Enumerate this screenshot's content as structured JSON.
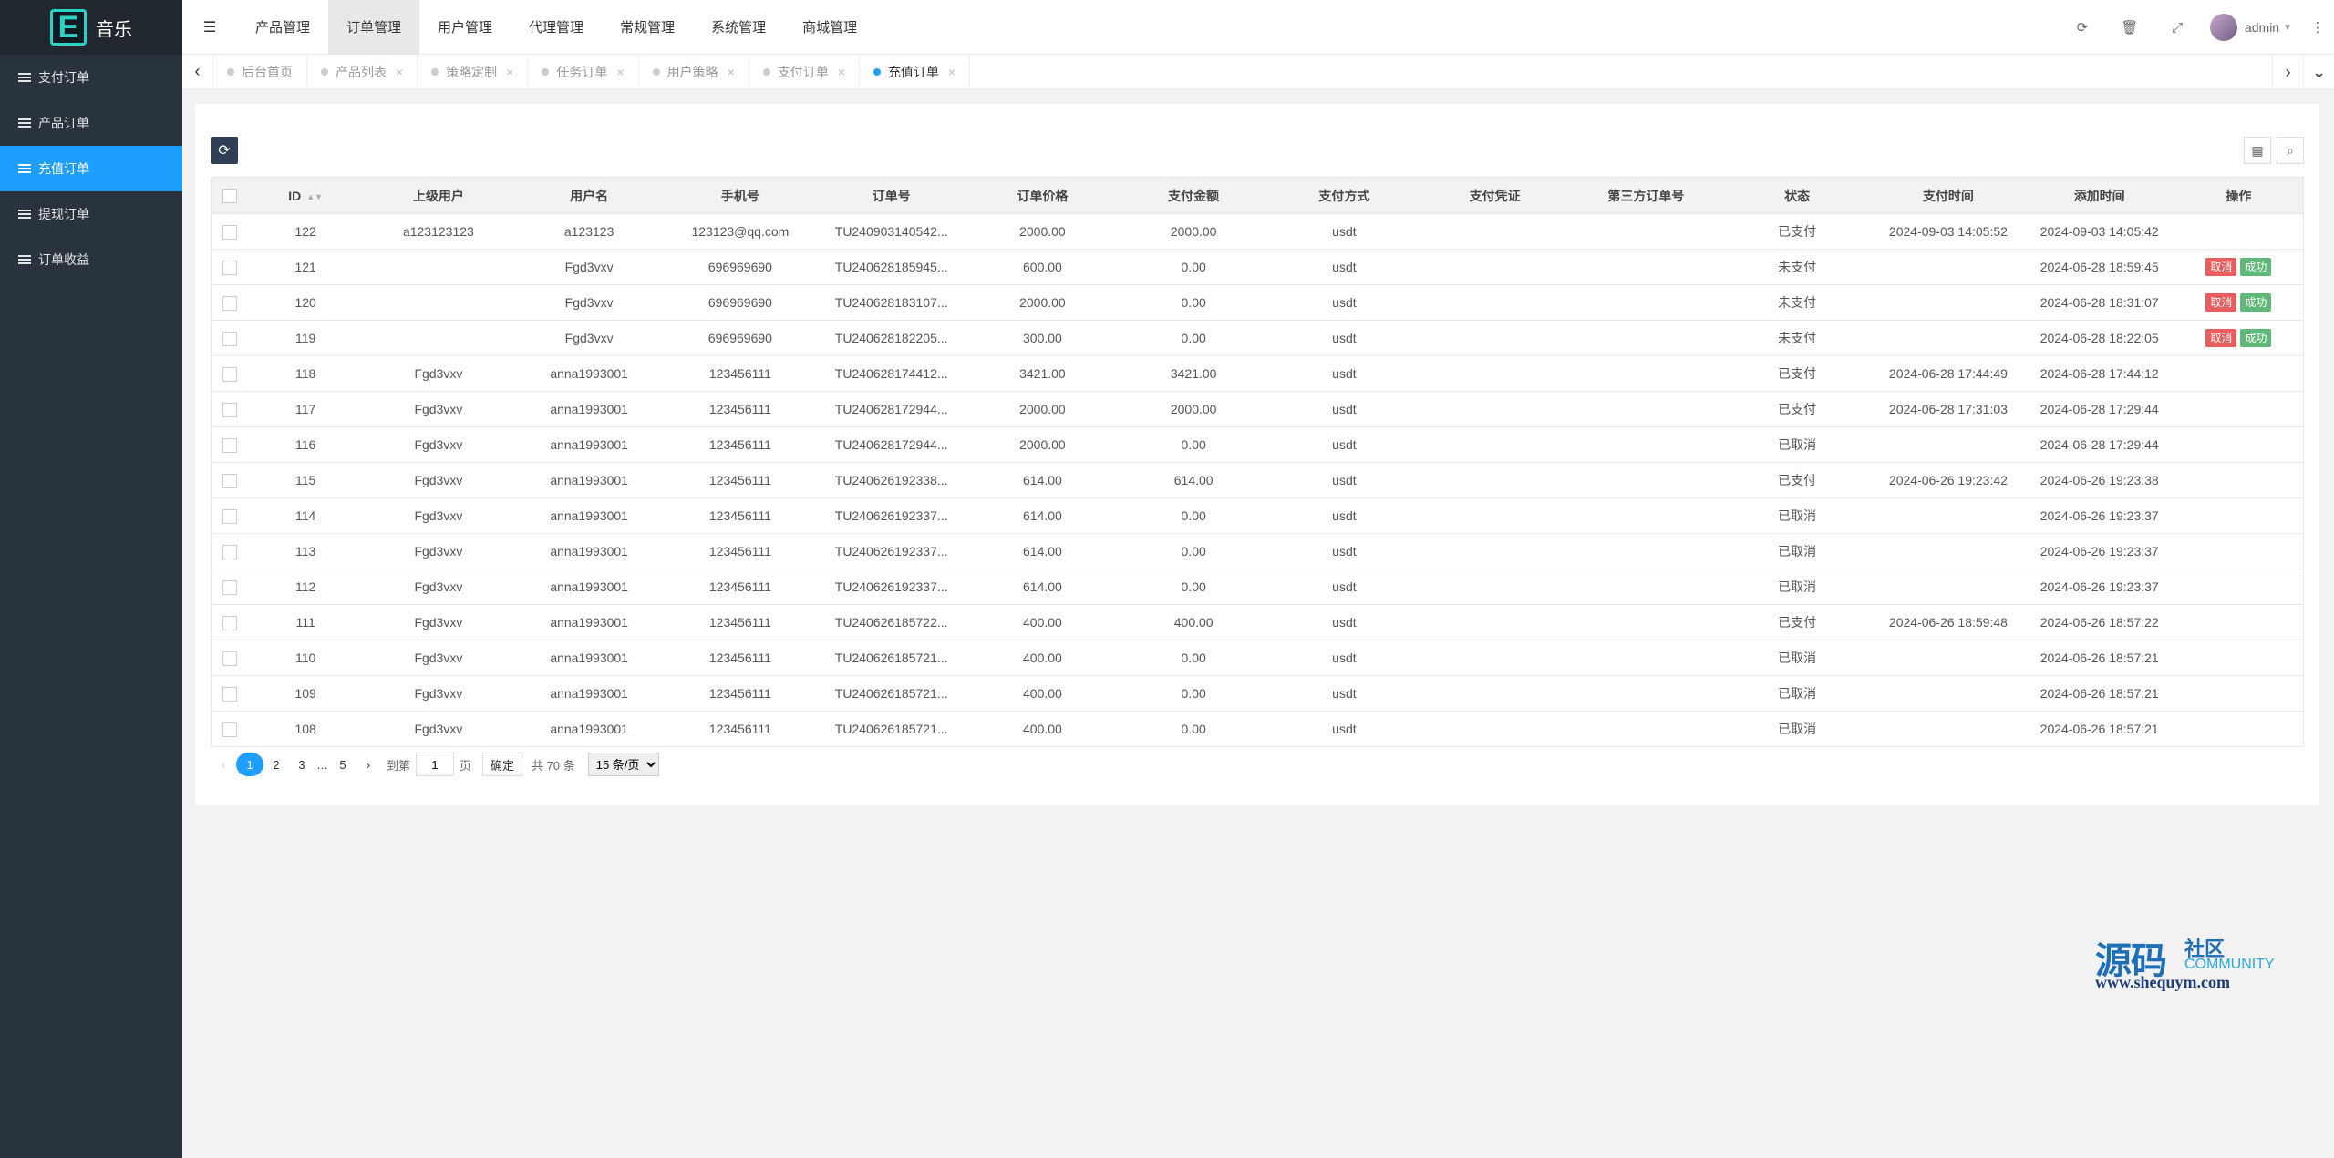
{
  "app": {
    "logo_letter": "E",
    "title": "音乐"
  },
  "sidebar": {
    "items": [
      {
        "label": "支付订单",
        "active": false
      },
      {
        "label": "产品订单",
        "active": false
      },
      {
        "label": "充值订单",
        "active": true
      },
      {
        "label": "提现订单",
        "active": false
      },
      {
        "label": "订单收益",
        "active": false
      }
    ]
  },
  "header": {
    "nav": [
      {
        "label": "产品管理",
        "active": false
      },
      {
        "label": "订单管理",
        "active": true
      },
      {
        "label": "用户管理",
        "active": false
      },
      {
        "label": "代理管理",
        "active": false
      },
      {
        "label": "常规管理",
        "active": false
      },
      {
        "label": "系统管理",
        "active": false
      },
      {
        "label": "商城管理",
        "active": false
      }
    ],
    "user": "admin"
  },
  "tabs": [
    {
      "label": "后台首页",
      "closable": false,
      "active": false
    },
    {
      "label": "产品列表",
      "closable": true,
      "active": false
    },
    {
      "label": "策略定制",
      "closable": true,
      "active": false
    },
    {
      "label": "任务订单",
      "closable": true,
      "active": false
    },
    {
      "label": "用户策略",
      "closable": true,
      "active": false
    },
    {
      "label": "支付订单",
      "closable": true,
      "active": false
    },
    {
      "label": "充值订单",
      "closable": true,
      "active": true
    }
  ],
  "table": {
    "columns": [
      "ID",
      "上级用户",
      "用户名",
      "手机号",
      "订单号",
      "订单价格",
      "支付金额",
      "支付方式",
      "支付凭证",
      "第三方订单号",
      "状态",
      "支付时间",
      "添加时间",
      "操作"
    ],
    "rows": [
      [
        "122",
        "a123123123",
        "a123123",
        "123123@qq.com",
        "TU240903140542...",
        "2000.00",
        "2000.00",
        "usdt",
        "",
        "",
        "已支付",
        "2024-09-03 14:05:52",
        "2024-09-03 14:05:42",
        ""
      ],
      [
        "121",
        "",
        "Fgd3vxv",
        "696969690",
        "TU240628185945...",
        "600.00",
        "0.00",
        "usdt",
        "",
        "",
        "未支付",
        "",
        "2024-06-28 18:59:45",
        "actions"
      ],
      [
        "120",
        "",
        "Fgd3vxv",
        "696969690",
        "TU240628183107...",
        "2000.00",
        "0.00",
        "usdt",
        "",
        "",
        "未支付",
        "",
        "2024-06-28 18:31:07",
        "actions"
      ],
      [
        "119",
        "",
        "Fgd3vxv",
        "696969690",
        "TU240628182205...",
        "300.00",
        "0.00",
        "usdt",
        "",
        "",
        "未支付",
        "",
        "2024-06-28 18:22:05",
        "actions"
      ],
      [
        "118",
        "Fgd3vxv",
        "anna1993001",
        "123456111",
        "TU240628174412...",
        "3421.00",
        "3421.00",
        "usdt",
        "",
        "",
        "已支付",
        "2024-06-28 17:44:49",
        "2024-06-28 17:44:12",
        ""
      ],
      [
        "117",
        "Fgd3vxv",
        "anna1993001",
        "123456111",
        "TU240628172944...",
        "2000.00",
        "2000.00",
        "usdt",
        "",
        "",
        "已支付",
        "2024-06-28 17:31:03",
        "2024-06-28 17:29:44",
        ""
      ],
      [
        "116",
        "Fgd3vxv",
        "anna1993001",
        "123456111",
        "TU240628172944...",
        "2000.00",
        "0.00",
        "usdt",
        "",
        "",
        "已取消",
        "",
        "2024-06-28 17:29:44",
        ""
      ],
      [
        "115",
        "Fgd3vxv",
        "anna1993001",
        "123456111",
        "TU240626192338...",
        "614.00",
        "614.00",
        "usdt",
        "",
        "",
        "已支付",
        "2024-06-26 19:23:42",
        "2024-06-26 19:23:38",
        ""
      ],
      [
        "114",
        "Fgd3vxv",
        "anna1993001",
        "123456111",
        "TU240626192337...",
        "614.00",
        "0.00",
        "usdt",
        "",
        "",
        "已取消",
        "",
        "2024-06-26 19:23:37",
        ""
      ],
      [
        "113",
        "Fgd3vxv",
        "anna1993001",
        "123456111",
        "TU240626192337...",
        "614.00",
        "0.00",
        "usdt",
        "",
        "",
        "已取消",
        "",
        "2024-06-26 19:23:37",
        ""
      ],
      [
        "112",
        "Fgd3vxv",
        "anna1993001",
        "123456111",
        "TU240626192337...",
        "614.00",
        "0.00",
        "usdt",
        "",
        "",
        "已取消",
        "",
        "2024-06-26 19:23:37",
        ""
      ],
      [
        "111",
        "Fgd3vxv",
        "anna1993001",
        "123456111",
        "TU240626185722...",
        "400.00",
        "400.00",
        "usdt",
        "",
        "",
        "已支付",
        "2024-06-26 18:59:48",
        "2024-06-26 18:57:22",
        ""
      ],
      [
        "110",
        "Fgd3vxv",
        "anna1993001",
        "123456111",
        "TU240626185721...",
        "400.00",
        "0.00",
        "usdt",
        "",
        "",
        "已取消",
        "",
        "2024-06-26 18:57:21",
        ""
      ],
      [
        "109",
        "Fgd3vxv",
        "anna1993001",
        "123456111",
        "TU240626185721...",
        "400.00",
        "0.00",
        "usdt",
        "",
        "",
        "已取消",
        "",
        "2024-06-26 18:57:21",
        ""
      ],
      [
        "108",
        "Fgd3vxv",
        "anna1993001",
        "123456111",
        "TU240626185721...",
        "400.00",
        "0.00",
        "usdt",
        "",
        "",
        "已取消",
        "",
        "2024-06-26 18:57:21",
        ""
      ]
    ],
    "action_cancel": "取消",
    "action_success": "成功"
  },
  "pager": {
    "pages": [
      "1",
      "2",
      "3",
      "5"
    ],
    "current": "1",
    "ellipsis": "…",
    "goto_prefix": "到第",
    "goto_value": "1",
    "goto_suffix": "页",
    "confirm": "确定",
    "total": "共 70 条",
    "page_size": "15 条/页"
  },
  "watermark": {
    "big": "源码",
    "small1": "社区",
    "small2": "COMMUNITY",
    "url": "www.shequym.com"
  },
  "colors": {
    "accent": "#1e9fff",
    "sidebar": "#28333e",
    "cancel": "#e85d5d",
    "success": "#5fb878"
  }
}
